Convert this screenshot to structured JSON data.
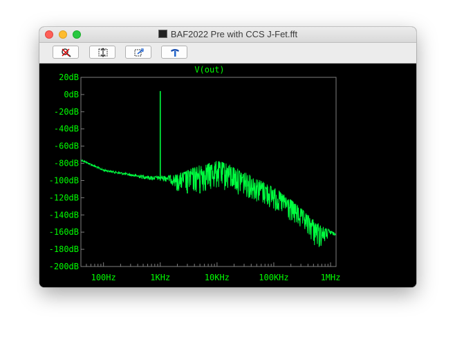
{
  "window": {
    "title": "BAF2022 Pre with CCS J-Fet.fft",
    "controls": [
      "close",
      "minimize",
      "maximize"
    ]
  },
  "toolbar": {
    "buttons": [
      {
        "icon": "zoom-cancel-icon"
      },
      {
        "icon": "zoom-extents-icon"
      },
      {
        "icon": "pan-icon"
      },
      {
        "icon": "hammer-icon"
      }
    ]
  },
  "colors": {
    "background": "#000000",
    "trace": "#00ff40",
    "grid_frame": "#808080",
    "label": "#00ff00"
  },
  "chart_data": {
    "type": "line",
    "title": "V(out)",
    "xlabel": "",
    "ylabel": "",
    "x_scale": "log",
    "xlim": [
      40,
      1250000
    ],
    "ylim": [
      -200,
      20
    ],
    "grid": false,
    "legend": "none",
    "x_ticks": [
      {
        "value": 100,
        "label": "100Hz"
      },
      {
        "value": 1000,
        "label": "1KHz"
      },
      {
        "value": 10000,
        "label": "10KHz"
      },
      {
        "value": 100000,
        "label": "100KHz"
      },
      {
        "value": 1000000,
        "label": "1MHz"
      }
    ],
    "y_ticks": [
      {
        "value": 20,
        "label": "20dB"
      },
      {
        "value": 0,
        "label": "0dB"
      },
      {
        "value": -20,
        "label": "-20dB"
      },
      {
        "value": -40,
        "label": "-40dB"
      },
      {
        "value": -60,
        "label": "-60dB"
      },
      {
        "value": -80,
        "label": "-80dB"
      },
      {
        "value": -100,
        "label": "-100dB"
      },
      {
        "value": -120,
        "label": "-120dB"
      },
      {
        "value": -140,
        "label": "-140dB"
      },
      {
        "value": -160,
        "label": "-160dB"
      },
      {
        "value": -180,
        "label": "-180dB"
      },
      {
        "value": -200,
        "label": "-200dB"
      }
    ],
    "series": [
      {
        "color": "#00ff40",
        "envelope_upper": [
          [
            40,
            -75
          ],
          [
            100,
            -87
          ],
          [
            300,
            -92
          ],
          [
            700,
            -95
          ],
          [
            1000,
            -95
          ],
          [
            2000,
            -93
          ],
          [
            3000,
            -88
          ],
          [
            5000,
            -82
          ],
          [
            7000,
            -80
          ],
          [
            10000,
            -77
          ],
          [
            15000,
            -80
          ],
          [
            30000,
            -90
          ],
          [
            60000,
            -100
          ],
          [
            100000,
            -108
          ],
          [
            200000,
            -122
          ],
          [
            400000,
            -140
          ],
          [
            700000,
            -153
          ],
          [
            1000000,
            -158
          ],
          [
            1250000,
            -162
          ]
        ],
        "envelope_lower": [
          [
            40,
            -77
          ],
          [
            100,
            -89
          ],
          [
            300,
            -95
          ],
          [
            700,
            -100
          ],
          [
            1000,
            -100
          ],
          [
            1500,
            -103
          ],
          [
            2000,
            -112
          ],
          [
            3000,
            -115
          ],
          [
            5000,
            -115
          ],
          [
            10000,
            -110
          ],
          [
            30000,
            -118
          ],
          [
            100000,
            -135
          ],
          [
            200000,
            -150
          ],
          [
            400000,
            -165
          ],
          [
            600000,
            -182
          ],
          [
            800000,
            -172
          ],
          [
            1000000,
            -165
          ],
          [
            1250000,
            -163
          ]
        ],
        "peaks": [
          {
            "x": 1000,
            "y": 4
          },
          {
            "x": 2000,
            "y": -95
          },
          {
            "x": 3000,
            "y": -97
          },
          {
            "x": 5000,
            "y": -100
          }
        ]
      }
    ]
  }
}
